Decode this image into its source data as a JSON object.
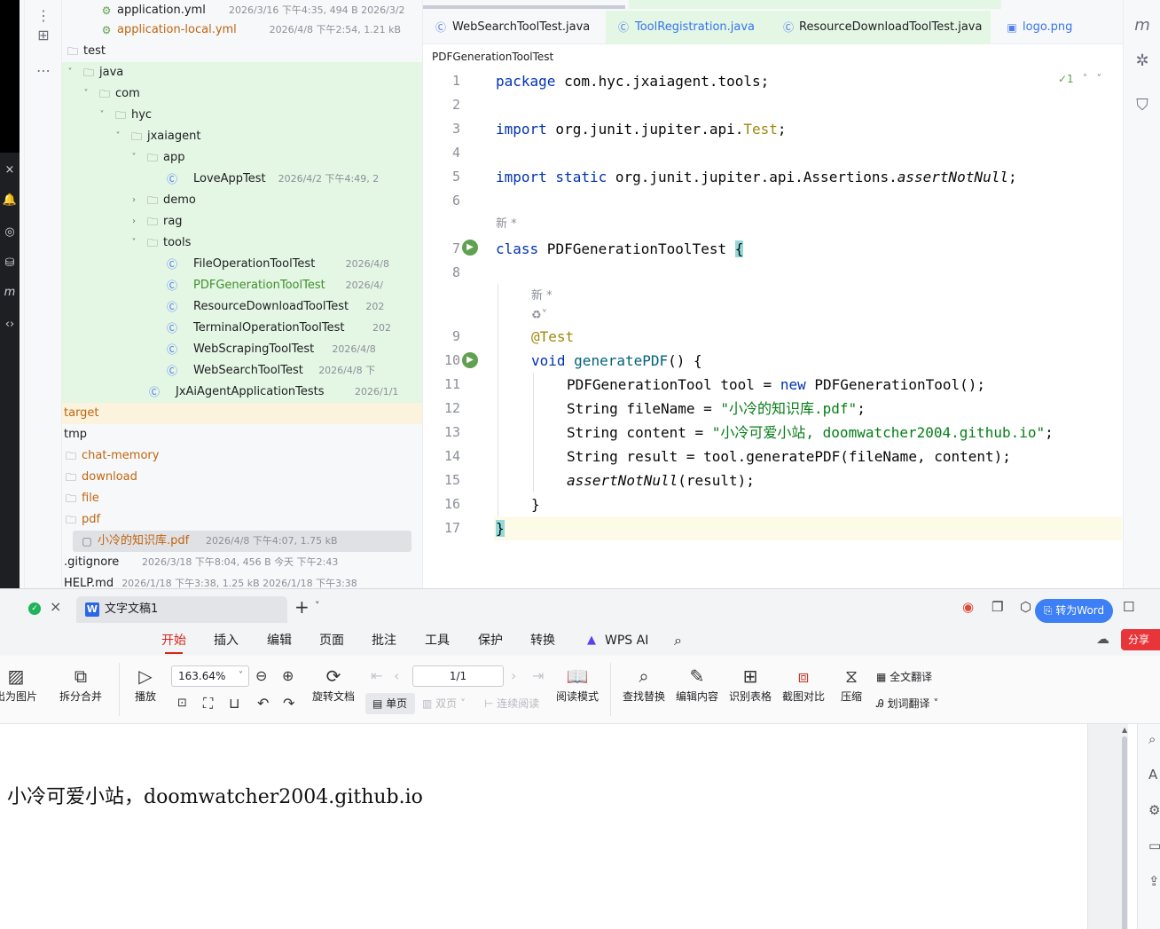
{
  "ide": {
    "tree": [
      {
        "label": "application.yml",
        "meta": "2026/3/16 下午4:35, 494 B 2026/3/2",
        "icon": "yml",
        "style": "dark"
      },
      {
        "label": "application-local.yml",
        "meta": "2026/4/8 下午2:54, 1.21 kB",
        "icon": "yml",
        "style": "orange"
      },
      {
        "label": "test",
        "meta": "",
        "icon": "folder",
        "style": "dark"
      },
      {
        "label": "java",
        "meta": "",
        "icon": "folder",
        "style": "dark"
      },
      {
        "label": "com",
        "meta": "",
        "icon": "folder",
        "style": "dark"
      },
      {
        "label": "hyc",
        "meta": "",
        "icon": "folder",
        "style": "dark"
      },
      {
        "label": "jxaiagent",
        "meta": "",
        "icon": "folder",
        "style": "dark"
      },
      {
        "label": "app",
        "meta": "",
        "icon": "folder",
        "style": "dark"
      },
      {
        "label": "LoveAppTest",
        "meta": "2026/4/2 下午4:49, 2",
        "icon": "test",
        "style": "dark"
      },
      {
        "label": "demo",
        "meta": "",
        "icon": "folder",
        "style": "dark"
      },
      {
        "label": "rag",
        "meta": "",
        "icon": "folder",
        "style": "dark"
      },
      {
        "label": "tools",
        "meta": "",
        "icon": "folder",
        "style": "dark"
      },
      {
        "label": "FileOperationToolTest",
        "meta": "2026/4/8",
        "icon": "test",
        "style": "dark"
      },
      {
        "label": "PDFGenerationToolTest",
        "meta": "2026/4/",
        "icon": "test",
        "style": "green"
      },
      {
        "label": "ResourceDownloadToolTest",
        "meta": "202",
        "icon": "test",
        "style": "dark"
      },
      {
        "label": "TerminalOperationToolTest",
        "meta": "202",
        "icon": "test",
        "style": "dark"
      },
      {
        "label": "WebScrapingToolTest",
        "meta": "2026/4/8",
        "icon": "test",
        "style": "dark"
      },
      {
        "label": "WebSearchToolTest",
        "meta": "2026/4/8 下",
        "icon": "test",
        "style": "dark"
      },
      {
        "label": "JxAiAgentApplicationTests",
        "meta": "2026/1/1",
        "icon": "test",
        "style": "dark"
      },
      {
        "label": "target",
        "meta": "",
        "icon": "folder",
        "style": "orange"
      },
      {
        "label": "tmp",
        "meta": "",
        "icon": "folder",
        "style": "dark"
      },
      {
        "label": "chat-memory",
        "meta": "",
        "icon": "folder",
        "style": "orange"
      },
      {
        "label": "download",
        "meta": "",
        "icon": "folder",
        "style": "orange"
      },
      {
        "label": "file",
        "meta": "",
        "icon": "folder",
        "style": "orange"
      },
      {
        "label": "pdf",
        "meta": "",
        "icon": "folder",
        "style": "orange"
      },
      {
        "label": "小冷的知识库.pdf",
        "meta": "2026/4/8 下午4:07, 1.75 kB",
        "icon": "file",
        "style": "orange"
      },
      {
        "label": ".gitignore",
        "meta": "2026/3/18 下午8:04, 456 B 今天 下午2:43",
        "icon": "ignore",
        "style": "dark"
      },
      {
        "label": "HELP.md",
        "meta": "2026/1/18 下午3:38, 1.25 kB 2026/1/18 下午3:38",
        "icon": "md",
        "style": "dark"
      }
    ],
    "tabs": [
      {
        "label": "WebSearchToolTest.java"
      },
      {
        "label": "ToolRegistration.java"
      },
      {
        "label": "ResourceDownloadToolTest.java"
      },
      {
        "label": "logo.png"
      }
    ],
    "breadcrumb": "PDFGenerationToolTest",
    "inspect": "✓1",
    "line_numbers": [
      "1",
      "2",
      "3",
      "4",
      "5",
      "6",
      "7",
      "8",
      "9",
      "10",
      "11",
      "12",
      "13",
      "14",
      "15",
      "16",
      "17"
    ],
    "inlay_new": "新 *",
    "code": {
      "l1_kw": "package",
      "l1_rest": " com.hyc.jxaiagent.tools;",
      "l3_kw": "import",
      "l3_mid": " org.junit.jupiter.api.",
      "l3_ann": "Test",
      "l3_end": ";",
      "l5_kw": "import static",
      "l5_mid": " org.junit.jupiter.api.Assertions.",
      "l5_it": "assertNotNull",
      "l5_end": ";",
      "l7_kw": "class",
      "l7_mid": " PDFGenerationToolTest ",
      "l7_brace": "{",
      "l9_ann": "@Test",
      "l10_kw": "void",
      "l10_mth": "generatePDF",
      "l10_end": "() {",
      "l11_a": "PDFGenerationTool tool = ",
      "l11_kw": "new",
      "l11_b": " PDFGenerationTool();",
      "l12_a": "String fileName = ",
      "l12_str": "\"小冷的知识库.pdf\"",
      "l12_b": ";",
      "l13_a": "String content = ",
      "l13_str": "\"小冷可爱小站, doomwatcher2004.github.io\"",
      "l13_b": ";",
      "l14": "String result = tool.generatePDF(fileName, content);",
      "l15_it": "assertNotNull",
      "l15_b": "(result);",
      "l16": "}",
      "l17": "}"
    }
  },
  "wps": {
    "doc_tab": "文字文稿1",
    "menu": [
      "开始",
      "插入",
      "编辑",
      "页面",
      "批注",
      "工具",
      "保护",
      "转换",
      "WPS AI"
    ],
    "share": "分享",
    "toolbar": {
      "to_image": "出为图片",
      "split_merge": "拆分合并",
      "play": "播放",
      "zoom": "163.64%",
      "rotate": "旋转文档",
      "single": "单页",
      "double": "双页",
      "continuous": "连续阅读",
      "page": "1/1",
      "read_mode": "阅读模式",
      "find_replace": "查找替换",
      "edit_content": "编辑内容",
      "recognize_table": "识别表格",
      "screenshot_compare": "截图对比",
      "compress": "压缩",
      "full_translate": "全文翻译",
      "word_translate": "划词翻译"
    },
    "to_word": "转为Word",
    "document_text": "小冷可爱小站，doomwatcher2004.github.io"
  }
}
